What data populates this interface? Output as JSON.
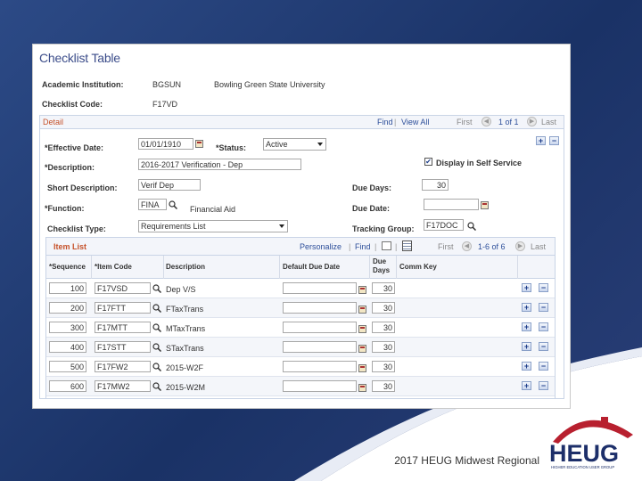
{
  "slide": {
    "footer": "2017 HEUG Midwest Regional",
    "logo_text": "HEUG",
    "logo_subtext": "HIGHER EDUCATION USER GROUP",
    "colors": {
      "background": "#1f3a6e",
      "logo_red": "#b8202f",
      "logo_navy": "#1d2f6a"
    }
  },
  "page": {
    "title": "Checklist Table",
    "academic_institution_label": "Academic Institution:",
    "academic_institution_code": "BGSUN",
    "academic_institution_name": "Bowling Green State University",
    "checklist_code_label": "Checklist Code:",
    "checklist_code_value": "F17VD"
  },
  "detail": {
    "header": "Detail",
    "find": "Find",
    "view_all": "View All",
    "first": "First",
    "range": "1 of 1",
    "last": "Last",
    "effective_date_label": "*Effective Date:",
    "effective_date_value": "01/01/1910",
    "status_label": "*Status:",
    "status_value": "Active",
    "description_label": "*Description:",
    "description_value": "2016-2017 Verification - Dep",
    "display_in_self_service_label": "Display in Self Service",
    "display_in_self_service_checked": true,
    "short_description_label": "Short Description:",
    "short_description_value": "Verif Dep",
    "due_days_label": "Due Days:",
    "due_days_value": "30",
    "function_label": "*Function:",
    "function_value": "FINA",
    "function_desc": "Financial Aid",
    "due_date_label": "Due Date:",
    "due_date_value": "",
    "checklist_type_label": "Checklist Type:",
    "checklist_type_value": "Requirements List",
    "tracking_group_label": "Tracking Group:",
    "tracking_group_value": "F17DOC"
  },
  "item_list": {
    "header": "Item List",
    "personalize": "Personalize",
    "find": "Find",
    "first": "First",
    "range": "1-6 of 6",
    "last": "Last",
    "columns": {
      "sequence": "*Sequence",
      "item_code": "*Item Code",
      "description": "Description",
      "default_due_date": "Default Due Date",
      "due_days": "Due Days",
      "comm_key": "Comm Key"
    },
    "rows": [
      {
        "sequence": "100",
        "item_code": "F17VSD",
        "description": "Dep V/S",
        "default_due_date": "",
        "due_days": "30"
      },
      {
        "sequence": "200",
        "item_code": "F17FTT",
        "description": "FTaxTrans",
        "default_due_date": "",
        "due_days": "30"
      },
      {
        "sequence": "300",
        "item_code": "F17MTT",
        "description": "MTaxTrans",
        "default_due_date": "",
        "due_days": "30"
      },
      {
        "sequence": "400",
        "item_code": "F17STT",
        "description": "STaxTrans",
        "default_due_date": "",
        "due_days": "30"
      },
      {
        "sequence": "500",
        "item_code": "F17FW2",
        "description": "2015-W2F",
        "default_due_date": "",
        "due_days": "30"
      },
      {
        "sequence": "600",
        "item_code": "F17MW2",
        "description": "2015-W2M",
        "default_due_date": "",
        "due_days": "30"
      }
    ]
  }
}
